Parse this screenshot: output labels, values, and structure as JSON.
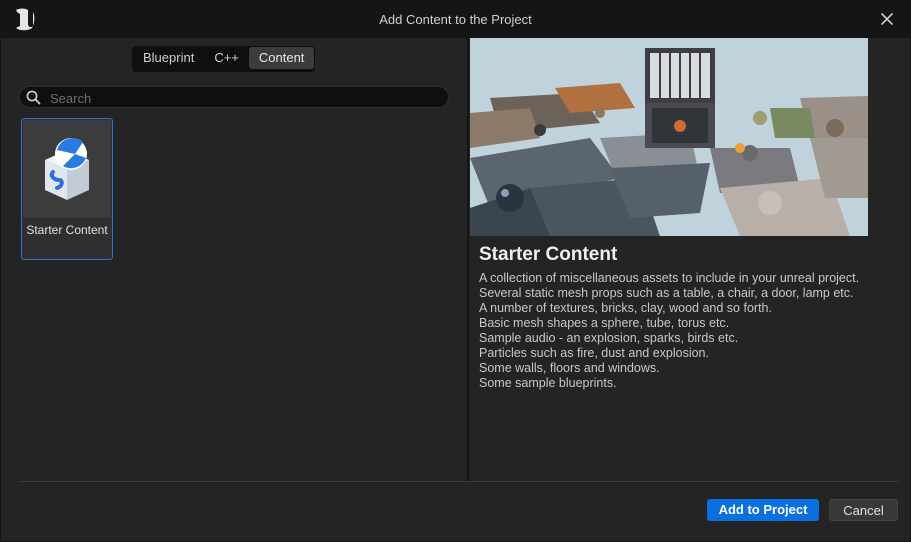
{
  "window": {
    "title": "Add Content to the Project"
  },
  "tabs": [
    {
      "label": "Blueprint",
      "active": false
    },
    {
      "label": "C++",
      "active": false
    },
    {
      "label": "Content",
      "active": true
    }
  ],
  "search": {
    "placeholder": "Search",
    "value": ""
  },
  "items": [
    {
      "label": "Starter Content",
      "selected": true,
      "icon": "starter-content-box-icon"
    }
  ],
  "details": {
    "title": "Starter Content",
    "description": [
      "A collection of miscellaneous assets to include in your unreal project.",
      "Several static mesh props such as a table, a chair, a door, lamp etc.",
      "A number of textures, bricks, clay, wood and so forth.",
      "Basic mesh shapes a sphere, tube, torus etc.",
      "Sample audio - an explosion, sparks, birds etc.",
      "Particles such as fire, dust and explosion.",
      "Some walls, floors and windows.",
      "Some sample blueprints."
    ]
  },
  "buttons": {
    "add": "Add to Project",
    "cancel": "Cancel"
  },
  "colors": {
    "accent": "#0a70e0",
    "selection_border": "#2b74d6",
    "background": "#242424",
    "titlebar": "#151515"
  }
}
